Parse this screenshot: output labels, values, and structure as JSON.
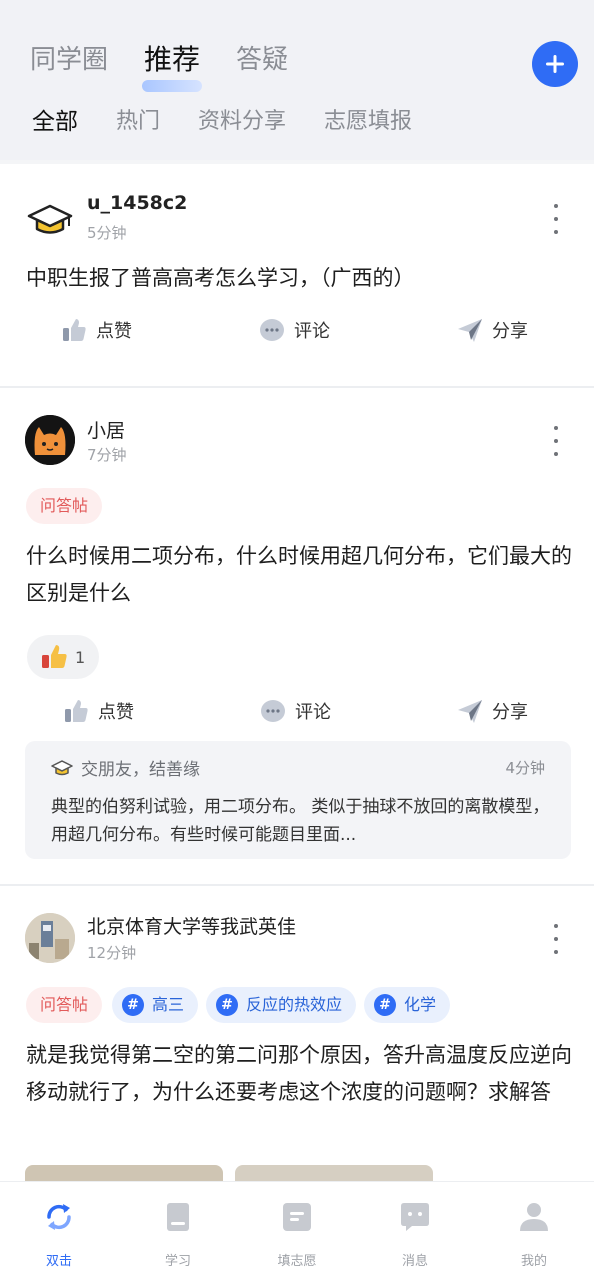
{
  "header": {
    "main_tabs": [
      "同学圈",
      "推荐",
      "答疑"
    ],
    "active_main_tab": 1,
    "sub_tabs": [
      "全部",
      "热门",
      "资料分享",
      "志愿填报"
    ],
    "active_sub_tab": 0
  },
  "posts": [
    {
      "username": "u_1458c2",
      "time": "5分钟",
      "content": "中职生报了普高高考怎么学习，（广西的）",
      "actions": {
        "like": "点赞",
        "comment": "评论",
        "share": "分享"
      }
    },
    {
      "username": "小居",
      "time": "7分钟",
      "tag": "问答帖",
      "content": "什么时候用二项分布，什么时候用超几何分布，它们最大的区别是什么",
      "reaction_count": "1",
      "actions": {
        "like": "点赞",
        "comment": "评论",
        "share": "分享"
      },
      "reply": {
        "author": "交朋友，结善缘",
        "time": "4分钟",
        "text": "典型的伯努利试验，用二项分布。 类似于抽球不放回的离散模型，用超几何分布。有些时候可能题目里面..."
      }
    },
    {
      "username": "北京体育大学等我武英佳",
      "time": "12分钟",
      "tag": "问答帖",
      "topics": [
        "高三",
        "反应的热效应",
        "化学"
      ],
      "content": "就是我觉得第二空的第二问那个原因，答升高温度反应逆向移动就行了，为什么还要考虑这个浓度的问题啊？求解答"
    }
  ],
  "bottom_nav": [
    {
      "label": "双击",
      "icon": "refresh-icon",
      "active": true
    },
    {
      "label": "学习",
      "icon": "book-icon",
      "active": false
    },
    {
      "label": "填志愿",
      "icon": "form-icon",
      "active": false
    },
    {
      "label": "消息",
      "icon": "message-icon",
      "active": false
    },
    {
      "label": "我的",
      "icon": "profile-icon",
      "active": false
    }
  ],
  "colors": {
    "accent": "#2f6cf5",
    "header_bg": "#f1f2f6",
    "qa_tag_text": "#e25a5a",
    "qa_tag_bg": "#fdeeee"
  }
}
